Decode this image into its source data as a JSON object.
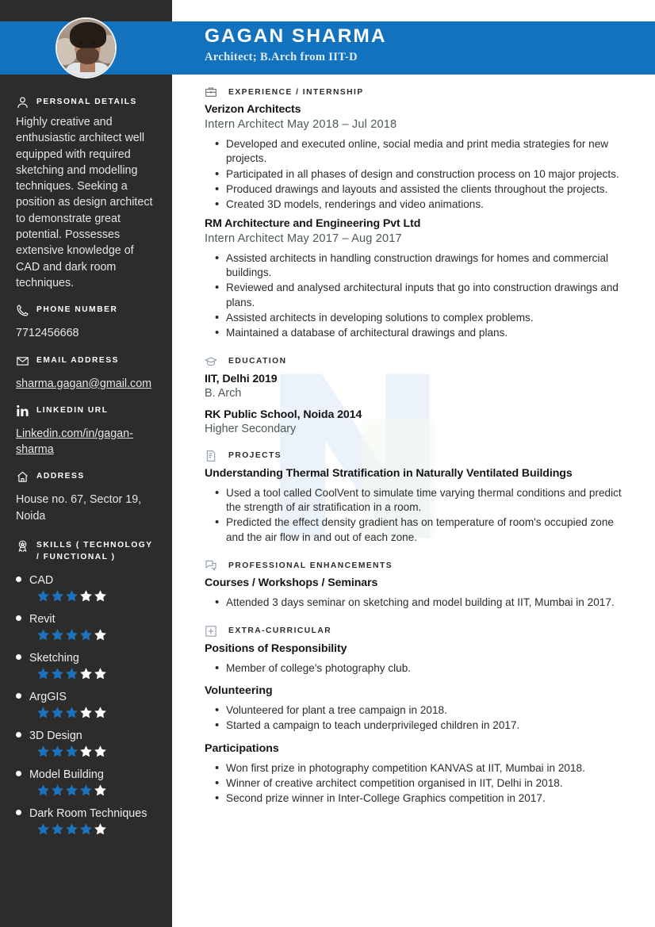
{
  "theme": {
    "accent": "#1372be",
    "sidebar_bg": "#2e2c2b",
    "star_on": "#1c72bd",
    "star_off": "#ffffff"
  },
  "header": {
    "name": "GAGAN SHARMA",
    "subtitle": "Architect; B.Arch from IIT-D",
    "avatar_alt": "profile-photo"
  },
  "sidebar": {
    "personal_details": {
      "title": "PERSONAL DETAILS",
      "icon": "person-icon",
      "text": "Highly creative and enthusiastic architect well equipped with required sketching and modelling techniques. Seeking a position as design architect to demonstrate great potential. Possesses extensive knowledge of CAD and dark room techniques."
    },
    "phone": {
      "title": "Phone Number",
      "icon": "phone-icon",
      "value": "7712456668"
    },
    "email": {
      "title": "Email Address",
      "icon": "envelope-icon",
      "value": "sharma.gagan@gmail.com"
    },
    "linkedin": {
      "title": "Linkedin URL",
      "icon": "linkedin-icon",
      "value": "Linkedin.com/in/gagan-sharma"
    },
    "address": {
      "title": "Address",
      "icon": "home-icon",
      "value": "House no. 67, Sector 19, Noida"
    },
    "skills": {
      "title": "SKILLS ( TECHNOLOGY / FUNCTIONAL )",
      "icon": "badge-icon",
      "max_stars": 5,
      "items": [
        {
          "name": "CAD",
          "rating": 3
        },
        {
          "name": "Revit",
          "rating": 4
        },
        {
          "name": "Sketching",
          "rating": 3
        },
        {
          "name": "ArgGIS",
          "rating": 3
        },
        {
          "name": "3D Design",
          "rating": 3
        },
        {
          "name": "Model Building",
          "rating": 4
        },
        {
          "name": "Dark Room Techniques",
          "rating": 4
        }
      ]
    }
  },
  "main": {
    "experience": {
      "title": "EXPERIENCE / INTERNSHIP",
      "icon": "briefcase-icon",
      "jobs": [
        {
          "org": "Verizon Architects",
          "role": "Intern Architect May 2018 – Jul 2018",
          "bullets": [
            "Developed and executed online, social media and print media strategies for new projects.",
            "Participated in all phases of design and construction process on 10 major projects.",
            "Produced drawings and layouts and assisted the clients throughout the projects.",
            "Created 3D models, renderings and video animations."
          ]
        },
        {
          "org": "RM Architecture and Engineering Pvt Ltd",
          "role": "Intern Architect May 2017 – Aug 2017",
          "bullets": [
            "Assisted architects in handling construction drawings for homes and commercial buildings.",
            "Reviewed and analysed architectural inputs that go into construction drawings and plans.",
            "Assisted architects in developing solutions to complex problems.",
            "Maintained a database of architectural drawings and plans."
          ]
        }
      ]
    },
    "education": {
      "title": "EDUCATION",
      "icon": "graduation-cap-icon",
      "entries": [
        {
          "school": "IIT, Delhi 2019",
          "degree": "B. Arch"
        },
        {
          "school": "RK Public School, Noida 2014",
          "degree": "Higher Secondary"
        }
      ]
    },
    "projects": {
      "title": "PROJECTS",
      "icon": "document-icon",
      "name": "Understanding Thermal Stratification in Naturally Ventilated Buildings",
      "bullets": [
        "Used a tool called CoolVent to simulate time varying thermal conditions and predict the strength of air stratification in a room.",
        "Predicted the effect density gradient has on temperature of room's occupied zone and the air flow in and out of each zone."
      ]
    },
    "professional_enhancements": {
      "title": "PROFESSIONAL ENHANCEMENTS",
      "icon": "speech-bubble-icon",
      "subhead": "Courses / Workshops / Seminars",
      "bullets": [
        "Attended 3 days seminar on sketching and model building at IIT, Mumbai in 2017."
      ]
    },
    "extra_curricular": {
      "title": "EXTRA-CURRICULAR",
      "icon": "plus-box-icon",
      "groups": [
        {
          "subhead": "Positions of Responsibility",
          "bullets": [
            "Member of college's photography club."
          ]
        },
        {
          "subhead": "Volunteering",
          "bullets": [
            "Volunteered for plant a tree campaign in 2018.",
            "Started a campaign to teach underprivileged children in 2017."
          ]
        },
        {
          "subhead": "Participations",
          "bullets": [
            "Won first prize in photography competition KANVAS at IIT, Mumbai in 2018.",
            "Winner of creative architect competition organised in IIT, Delhi in 2018.",
            "Second prize winner in Inter-College Graphics competition in 2017."
          ]
        }
      ]
    }
  }
}
